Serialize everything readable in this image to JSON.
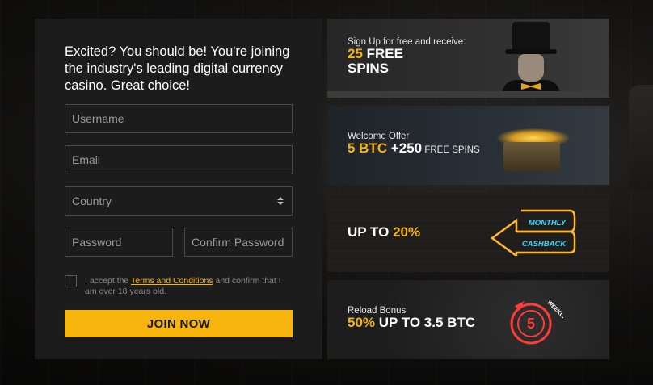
{
  "form": {
    "intro": "Excited? You should be! You're joining the industry's leading digital currency casino. Great choice!",
    "username_placeholder": "Username",
    "email_placeholder": "Email",
    "country_placeholder": "Country",
    "password_placeholder": "Password",
    "confirm_password_placeholder": "Confirm Password",
    "terms_prefix": "I accept the ",
    "terms_link": "Terms and Conditions",
    "terms_suffix": " and confirm that I am over 18 years old.",
    "join_label": "JOIN NOW"
  },
  "promos": [
    {
      "line1": "Sign Up for free and receive:",
      "highlight": "25",
      "rest": " FREE",
      "line3": "SPINS"
    },
    {
      "line1": "Welcome Offer",
      "highlight": "5 BTC",
      "rest": " +250",
      "small": " FREE SPINS"
    },
    {
      "prefix": "UP TO ",
      "highlight": "20%",
      "neon_top": "MONTHLY",
      "neon_bottom": "CASHBACK"
    },
    {
      "line1": "Reload Bonus",
      "highlight": "50%",
      "rest": " UP TO 3.5 BTC",
      "badge": "WEEKLY RELOAD"
    }
  ],
  "colors": {
    "accent": "#f7b40d",
    "panel": "#1c1c1c",
    "neon_blue": "#38d8ff",
    "neon_orange": "#ffb52e",
    "neon_red": "#ff3b3b"
  }
}
